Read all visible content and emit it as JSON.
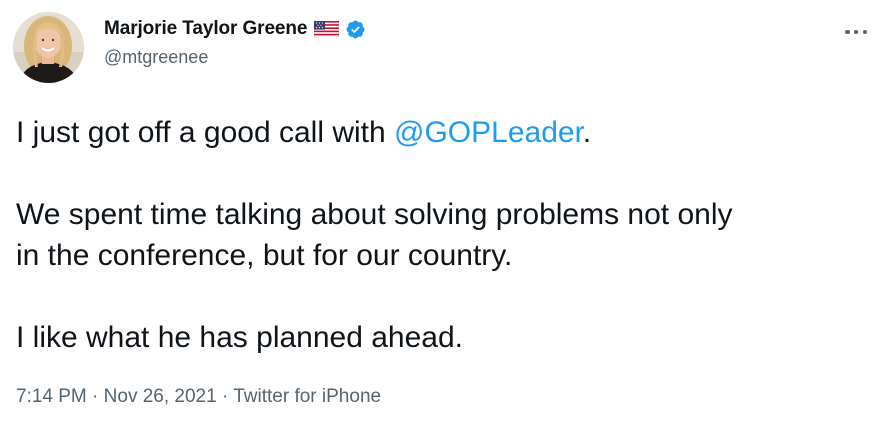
{
  "author": {
    "display_name": "Marjorie Taylor Greene",
    "handle": "@mtgreenee",
    "verified": true,
    "flag_icon": "us-flag-icon"
  },
  "tweet": {
    "line1_prefix": "I just got off a good call with ",
    "mention": "@GOPLeader",
    "line1_suffix": ".",
    "paragraph2_line1": "We spent time talking about solving problems not only",
    "paragraph2_line2": "in the conference, but for our country.",
    "paragraph3": "I like what he has planned ahead."
  },
  "meta": {
    "time": "7:14 PM",
    "separator1": " · ",
    "date": "Nov 26, 2021",
    "separator2": " · ",
    "source": "Twitter for iPhone"
  },
  "colors": {
    "link": "#1d9bf0",
    "text": "#0f1419",
    "secondary": "#536471",
    "verified": "#1d9bf0"
  },
  "icons": [
    "avatar",
    "us-flag-icon",
    "verified-badge-icon",
    "more-options-icon"
  ]
}
